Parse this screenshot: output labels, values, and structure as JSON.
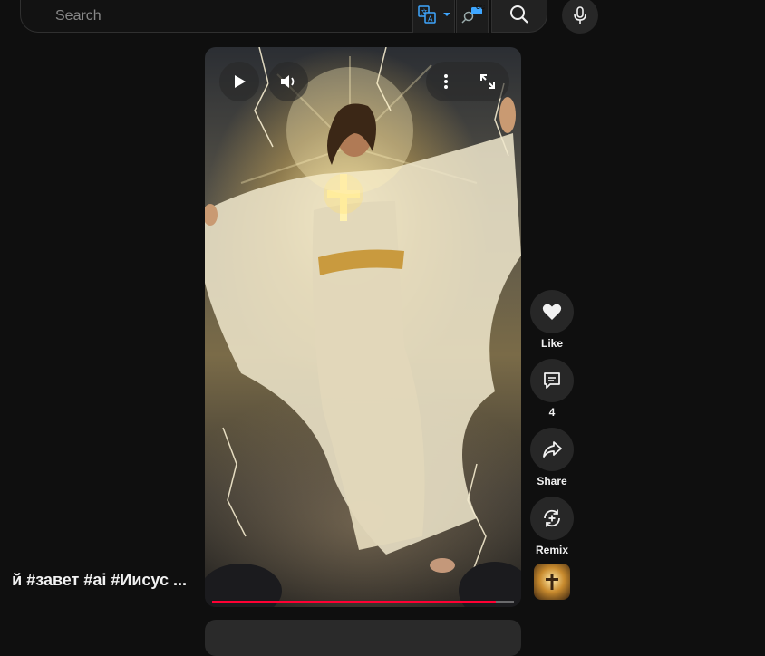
{
  "search": {
    "placeholder": "Search"
  },
  "toolbar": {
    "translate_icon": "translate-icon",
    "dropdown_icon": "caret-down-icon",
    "cc_badge": "CC",
    "search_icon": "search-icon",
    "mic_icon": "microphone-icon"
  },
  "video": {
    "play_icon": "play-icon",
    "volume_icon": "volume-icon",
    "more_icon": "more-vert-icon",
    "fullscreen_icon": "fullscreen-icon",
    "progress_fraction": 0.94,
    "progress_color": "#ff0033"
  },
  "actions": {
    "like_label": "Like",
    "comments_count": "4",
    "share_label": "Share",
    "remix_label": "Remix"
  },
  "caption": {
    "text": "й  #завет #ai #Иисус ..."
  },
  "colors": {
    "background": "#0f0f0f",
    "button_bg": "#272727",
    "accent": "#3ea6ff"
  }
}
